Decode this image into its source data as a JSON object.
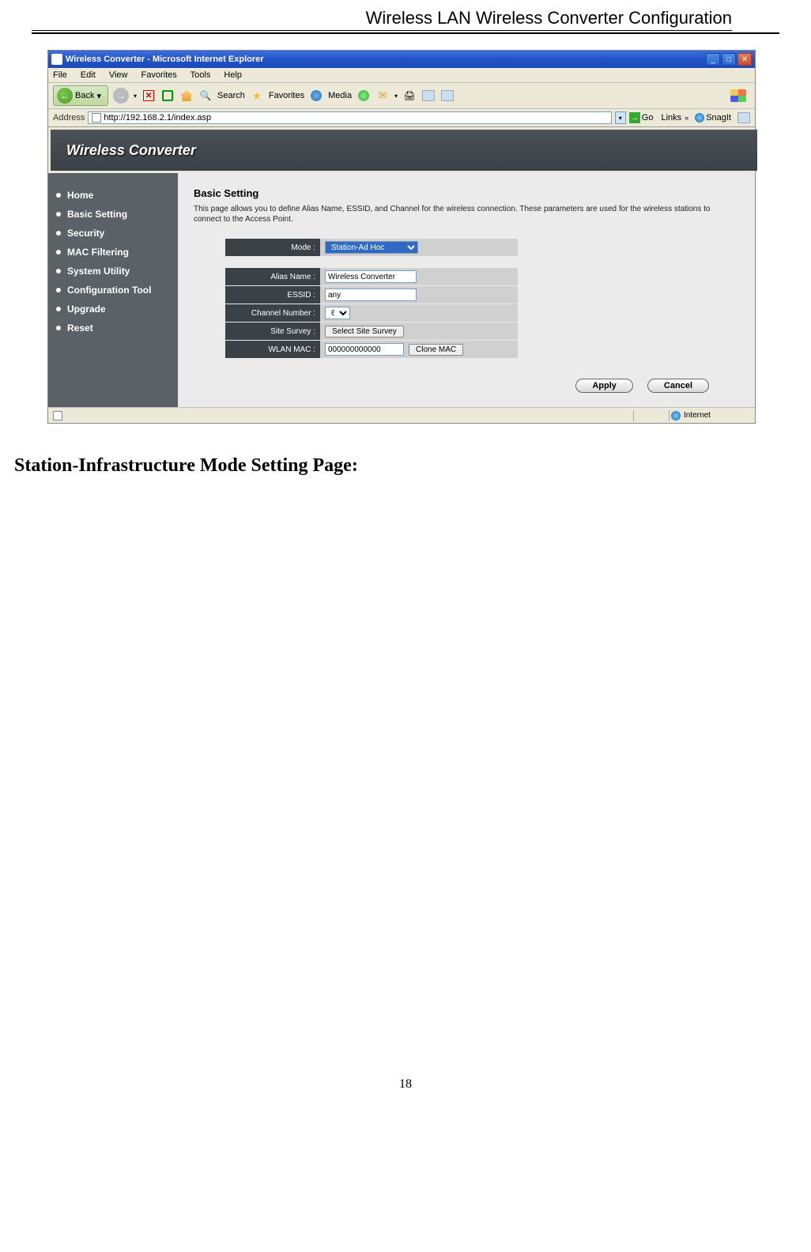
{
  "doc": {
    "header": "Wireless LAN Wireless Converter Configuration",
    "section_heading": "Station-Infrastructure Mode Setting Page:",
    "page_number": "18"
  },
  "window": {
    "title": "Wireless Converter - Microsoft Internet Explorer"
  },
  "menubar": {
    "file": "File",
    "edit": "Edit",
    "view": "View",
    "favorites": "Favorites",
    "tools": "Tools",
    "help": "Help"
  },
  "toolbar": {
    "back": "Back",
    "search": "Search",
    "favorites": "Favorites",
    "media": "Media"
  },
  "addrbar": {
    "label": "Address",
    "value": "http://192.168.2.1/index.asp",
    "go": "Go",
    "links": "Links",
    "snagit": "SnagIt"
  },
  "banner": "Wireless Converter",
  "sidebar": {
    "items": [
      "Home",
      "Basic Setting",
      "Security",
      "MAC Filtering",
      "System Utility",
      "Configuration Tool",
      "Upgrade",
      "Reset"
    ]
  },
  "content": {
    "title": "Basic Setting",
    "desc": "This page allows you to define Alias Name, ESSID, and Channel for the wireless connection. These parameters are used for the wireless stations to connect to the Access Point.",
    "mode_label": "Mode :",
    "mode_value": "Station-Ad Hoc",
    "alias_label": "Alias Name :",
    "alias_value": "Wireless Converter",
    "essid_label": "ESSID :",
    "essid_value": "any",
    "channel_label": "Channel Number :",
    "channel_value": "6",
    "survey_label": "Site Survey :",
    "survey_btn": "Select Site Survey",
    "mac_label": "WLAN MAC :",
    "mac_value": "000000000000",
    "clone_btn": "Clone MAC",
    "apply": "Apply",
    "cancel": "Cancel"
  },
  "statusbar": {
    "zone": "Internet"
  }
}
